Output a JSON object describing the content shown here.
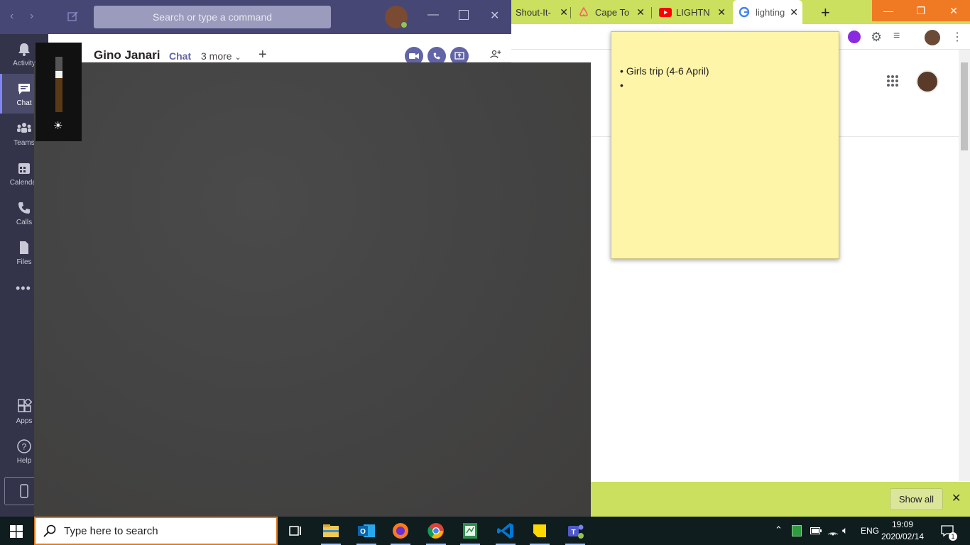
{
  "chrome": {
    "tabs": [
      {
        "title": "Shout-It-"
      },
      {
        "title": "Cape Tow"
      },
      {
        "title": "LIGHTNIN"
      },
      {
        "title": "lighting n"
      }
    ],
    "new_tab_glyph": "+",
    "download_bar": {
      "show_all_label": "Show all"
    },
    "accent_color": "#cbe05f"
  },
  "teams": {
    "search_placeholder": "Search or type a command",
    "rail": [
      {
        "label": "Activity",
        "icon": "bell-icon"
      },
      {
        "label": "Chat",
        "icon": "chat-icon",
        "active": true
      },
      {
        "label": "Teams",
        "icon": "teams-icon"
      },
      {
        "label": "Calendar",
        "icon": "calendar-icon"
      },
      {
        "label": "Calls",
        "icon": "phone-icon"
      },
      {
        "label": "Files",
        "icon": "file-icon"
      },
      {
        "label": "Apps",
        "icon": "apps-icon"
      },
      {
        "label": "Help",
        "icon": "help-icon"
      }
    ],
    "chat": {
      "name": "Gino Janari",
      "active_tab": "Chat",
      "more_tabs": "3 more"
    },
    "brand_color": "#464775"
  },
  "sticky_note": {
    "items": [
      "Girls trip (4-6 April)",
      ""
    ]
  },
  "taskbar": {
    "search_placeholder": "Type here to search",
    "language": "ENG",
    "time": "19:09",
    "date": "2020/02/14",
    "notification_count": "1"
  }
}
